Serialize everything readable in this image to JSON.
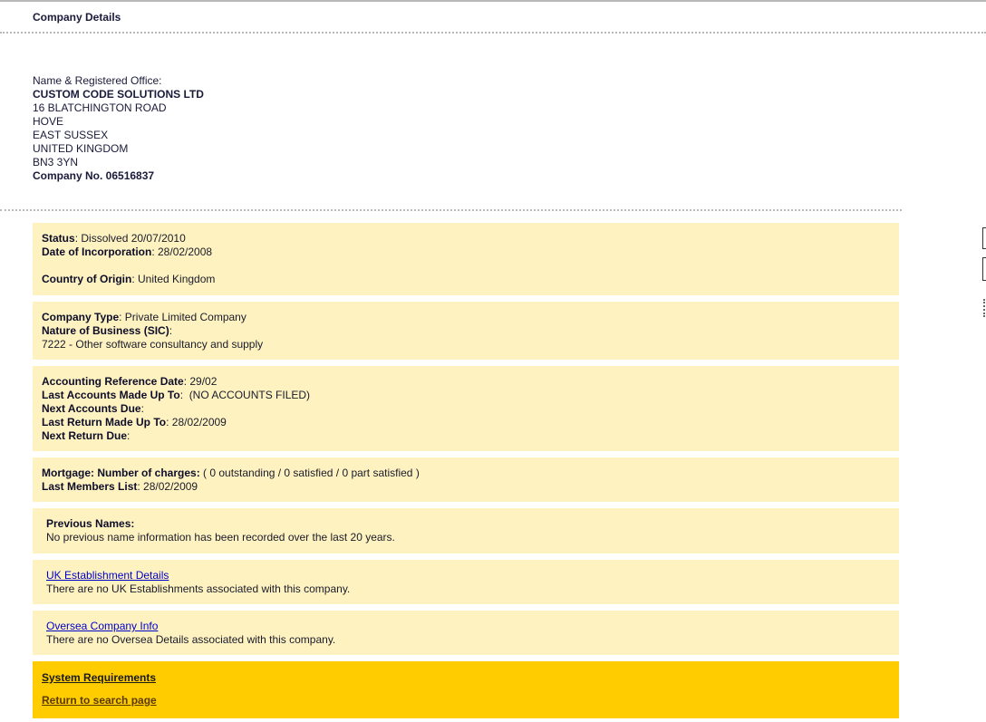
{
  "header": {
    "title": "Company Details"
  },
  "office": {
    "label": "Name & Registered Office:",
    "name": "CUSTOM CODE SOLUTIONS LTD",
    "address": [
      "16 BLATCHINGTON ROAD",
      "HOVE",
      "EAST SUSSEX",
      "UNITED KINGDOM",
      "BN3 3YN"
    ],
    "company_no": "Company No. 06516837"
  },
  "status_panel": {
    "status_label": "Status",
    "status_value": ": Dissolved 20/07/2010",
    "incorporation_label": "Date of Incorporation",
    "incorporation_value": ": 28/02/2008",
    "origin_label": "Country of Origin",
    "origin_value": ": United Kingdom"
  },
  "type_panel": {
    "type_label": "Company Type",
    "type_value": ": Private Limited Company",
    "sic_label": "Nature of Business (SIC)",
    "sic_suffix": ":",
    "sic_value": "7222 - Other software consultancy and supply"
  },
  "accounts_panel": {
    "ard_label": "Accounting Reference Date",
    "ard_value": ": 29/02",
    "last_accounts_label": "Last Accounts Made Up To",
    "last_accounts_value": ":  (NO ACCOUNTS FILED)",
    "next_accounts_label": "Next Accounts Due",
    "next_accounts_value": ":",
    "last_return_label": "Last Return Made Up To",
    "last_return_value": ": 28/02/2009",
    "next_return_label": "Next Return Due",
    "next_return_value": ":"
  },
  "mortgage_panel": {
    "mortgage_label": "Mortgage: Number of charges:",
    "mortgage_value": " ( 0 outstanding / 0 satisfied / 0 part satisfied )",
    "members_label": "Last Members List",
    "members_value": ": 28/02/2009"
  },
  "names_panel": {
    "label": "Previous Names:",
    "text": "No previous name information has been recorded over the last 20 years."
  },
  "uk_panel": {
    "link": "UK Establishment Details",
    "text": "There are no UK Establishments associated with this company."
  },
  "oversea_panel": {
    "link": "Oversea Company Info",
    "text": "There are no Oversea Details associated with this company."
  },
  "footer": {
    "system_requirements": "System Requirements",
    "return_link": "Return to search page"
  },
  "colors": {
    "panel_bg": "#fef3c0",
    "footer_bg": "#ffcc00",
    "link": "#0000cc"
  }
}
